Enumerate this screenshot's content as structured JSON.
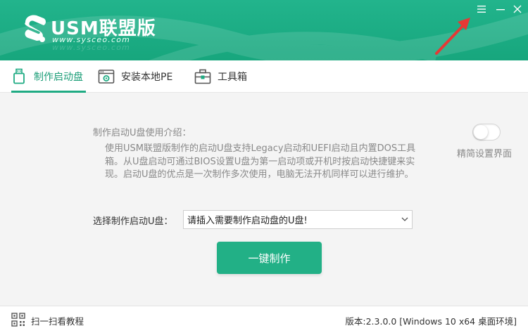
{
  "header": {
    "brand": "USM联盟版",
    "url": "www.sysceo.com"
  },
  "window_controls": {
    "menu": "menu-icon",
    "minimize": "minimize-icon",
    "close": "close-icon"
  },
  "tabs": [
    {
      "label": "制作启动盘",
      "icon": "usb-drive-icon",
      "active": true
    },
    {
      "label": "安装本地PE",
      "icon": "pe-window-icon",
      "active": false
    },
    {
      "label": "工具箱",
      "icon": "toolbox-icon",
      "active": false
    }
  ],
  "main": {
    "intro_title": "制作启动U盘使用介绍：",
    "intro_text": "使用USM联盟版制作的启动U盘支持Legacy启动和UEFI启动且内置DOS工具箱。从U盘启动可通过BIOS设置U盘为第一启动项或开机时按启动快捷键来实现。启动U盘的优点是一次制作多次使用，电脑无法开机同样可以进行维护。",
    "toggle_label": "精简设置界面",
    "toggle_on": false,
    "select_label": "选择制作启动U盘：",
    "select_value": "请插入需要制作启动盘的U盘!",
    "make_button": "一键制作"
  },
  "footer": {
    "qr_label": "扫一扫看教程",
    "version": "版本:2.3.0.0 [Windows 10 x64 桌面环境]"
  },
  "colors": {
    "accent": "#1fab83",
    "header": "#1aab82",
    "arrow": "#e53935"
  }
}
